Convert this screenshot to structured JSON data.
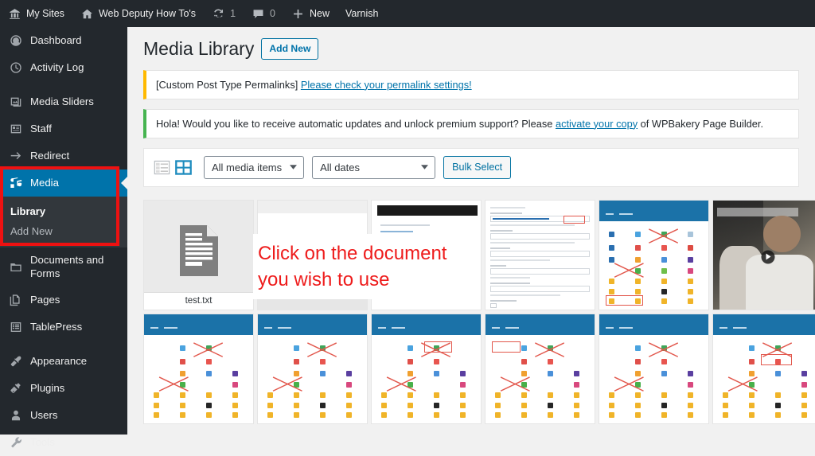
{
  "adminbar": {
    "items": [
      {
        "icon": "wordpress-sites-icon",
        "label": "My Sites",
        "count": ""
      },
      {
        "icon": "home-icon",
        "label": "Web Deputy How To's",
        "count": ""
      },
      {
        "icon": "updates-icon",
        "label": "",
        "count": "1"
      },
      {
        "icon": "comments-icon",
        "label": "",
        "count": "0"
      },
      {
        "icon": "plus-icon",
        "label": "New",
        "count": ""
      },
      {
        "icon": "",
        "label": "Varnish",
        "count": ""
      }
    ]
  },
  "sidebar": {
    "items": [
      {
        "icon": "dashboard-icon",
        "label": "Dashboard"
      },
      {
        "icon": "activity-log-icon",
        "label": "Activity Log"
      },
      {
        "icon": "media-sliders-icon",
        "label": "Media Sliders"
      },
      {
        "icon": "staff-icon",
        "label": "Staff"
      },
      {
        "icon": "redirect-icon",
        "label": "Redirect"
      },
      {
        "icon": "media-icon",
        "label": "Media"
      },
      {
        "icon": "documents-forms-icon",
        "label": "Documents and Forms"
      },
      {
        "icon": "pages-icon",
        "label": "Pages"
      },
      {
        "icon": "tablepress-icon",
        "label": "TablePress"
      },
      {
        "icon": "appearance-icon",
        "label": "Appearance"
      },
      {
        "icon": "plugins-icon",
        "label": "Plugins"
      },
      {
        "icon": "users-icon",
        "label": "Users"
      },
      {
        "icon": "tools-icon",
        "label": "Tools"
      }
    ],
    "media_submenu": [
      {
        "label": "Library",
        "current": true
      },
      {
        "label": "Add New",
        "current": false
      }
    ],
    "active_color": "#0073aa",
    "highlight_color": "#ee1111"
  },
  "page": {
    "title": "Media Library",
    "add_new_label": "Add New"
  },
  "notices": [
    {
      "type": "warning",
      "accent": "#ffb900",
      "prefix": "[Custom Post Type Permalinks] ",
      "link": "Please check your permalink settings!",
      "suffix": ""
    },
    {
      "type": "success",
      "accent": "#46b450",
      "prefix": "Hola! Would you like to receive automatic updates and unlock premium support? Please ",
      "link": "activate your copy",
      "suffix": " of WPBakery Page Builder."
    }
  ],
  "toolbar": {
    "list_view_icon": "list-view-icon",
    "grid_view_icon": "grid-view-icon",
    "media_filter_value": "All media items",
    "dates_filter_value": "All dates",
    "bulk_select_label": "Bulk Select"
  },
  "grid": {
    "selected_filename": "test.txt",
    "selected_icon": "document-icon",
    "items": [
      {
        "kind": "document",
        "name": "test.txt"
      },
      {
        "kind": "screenshot-blank"
      },
      {
        "kind": "screenshot-blackbar"
      },
      {
        "kind": "screenshot-form"
      },
      {
        "kind": "screenshot-dashboard"
      },
      {
        "kind": "photo-athlete"
      },
      {
        "kind": "screenshot-dashboard"
      },
      {
        "kind": "screenshot-dashboard"
      },
      {
        "kind": "screenshot-dashboard"
      },
      {
        "kind": "screenshot-dashboard"
      },
      {
        "kind": "screenshot-dashboard"
      },
      {
        "kind": "screenshot-dashboard"
      }
    ]
  },
  "annotation": {
    "line1": "Click on the document",
    "line2": "you wish to use",
    "color": "#ee1c1c"
  }
}
